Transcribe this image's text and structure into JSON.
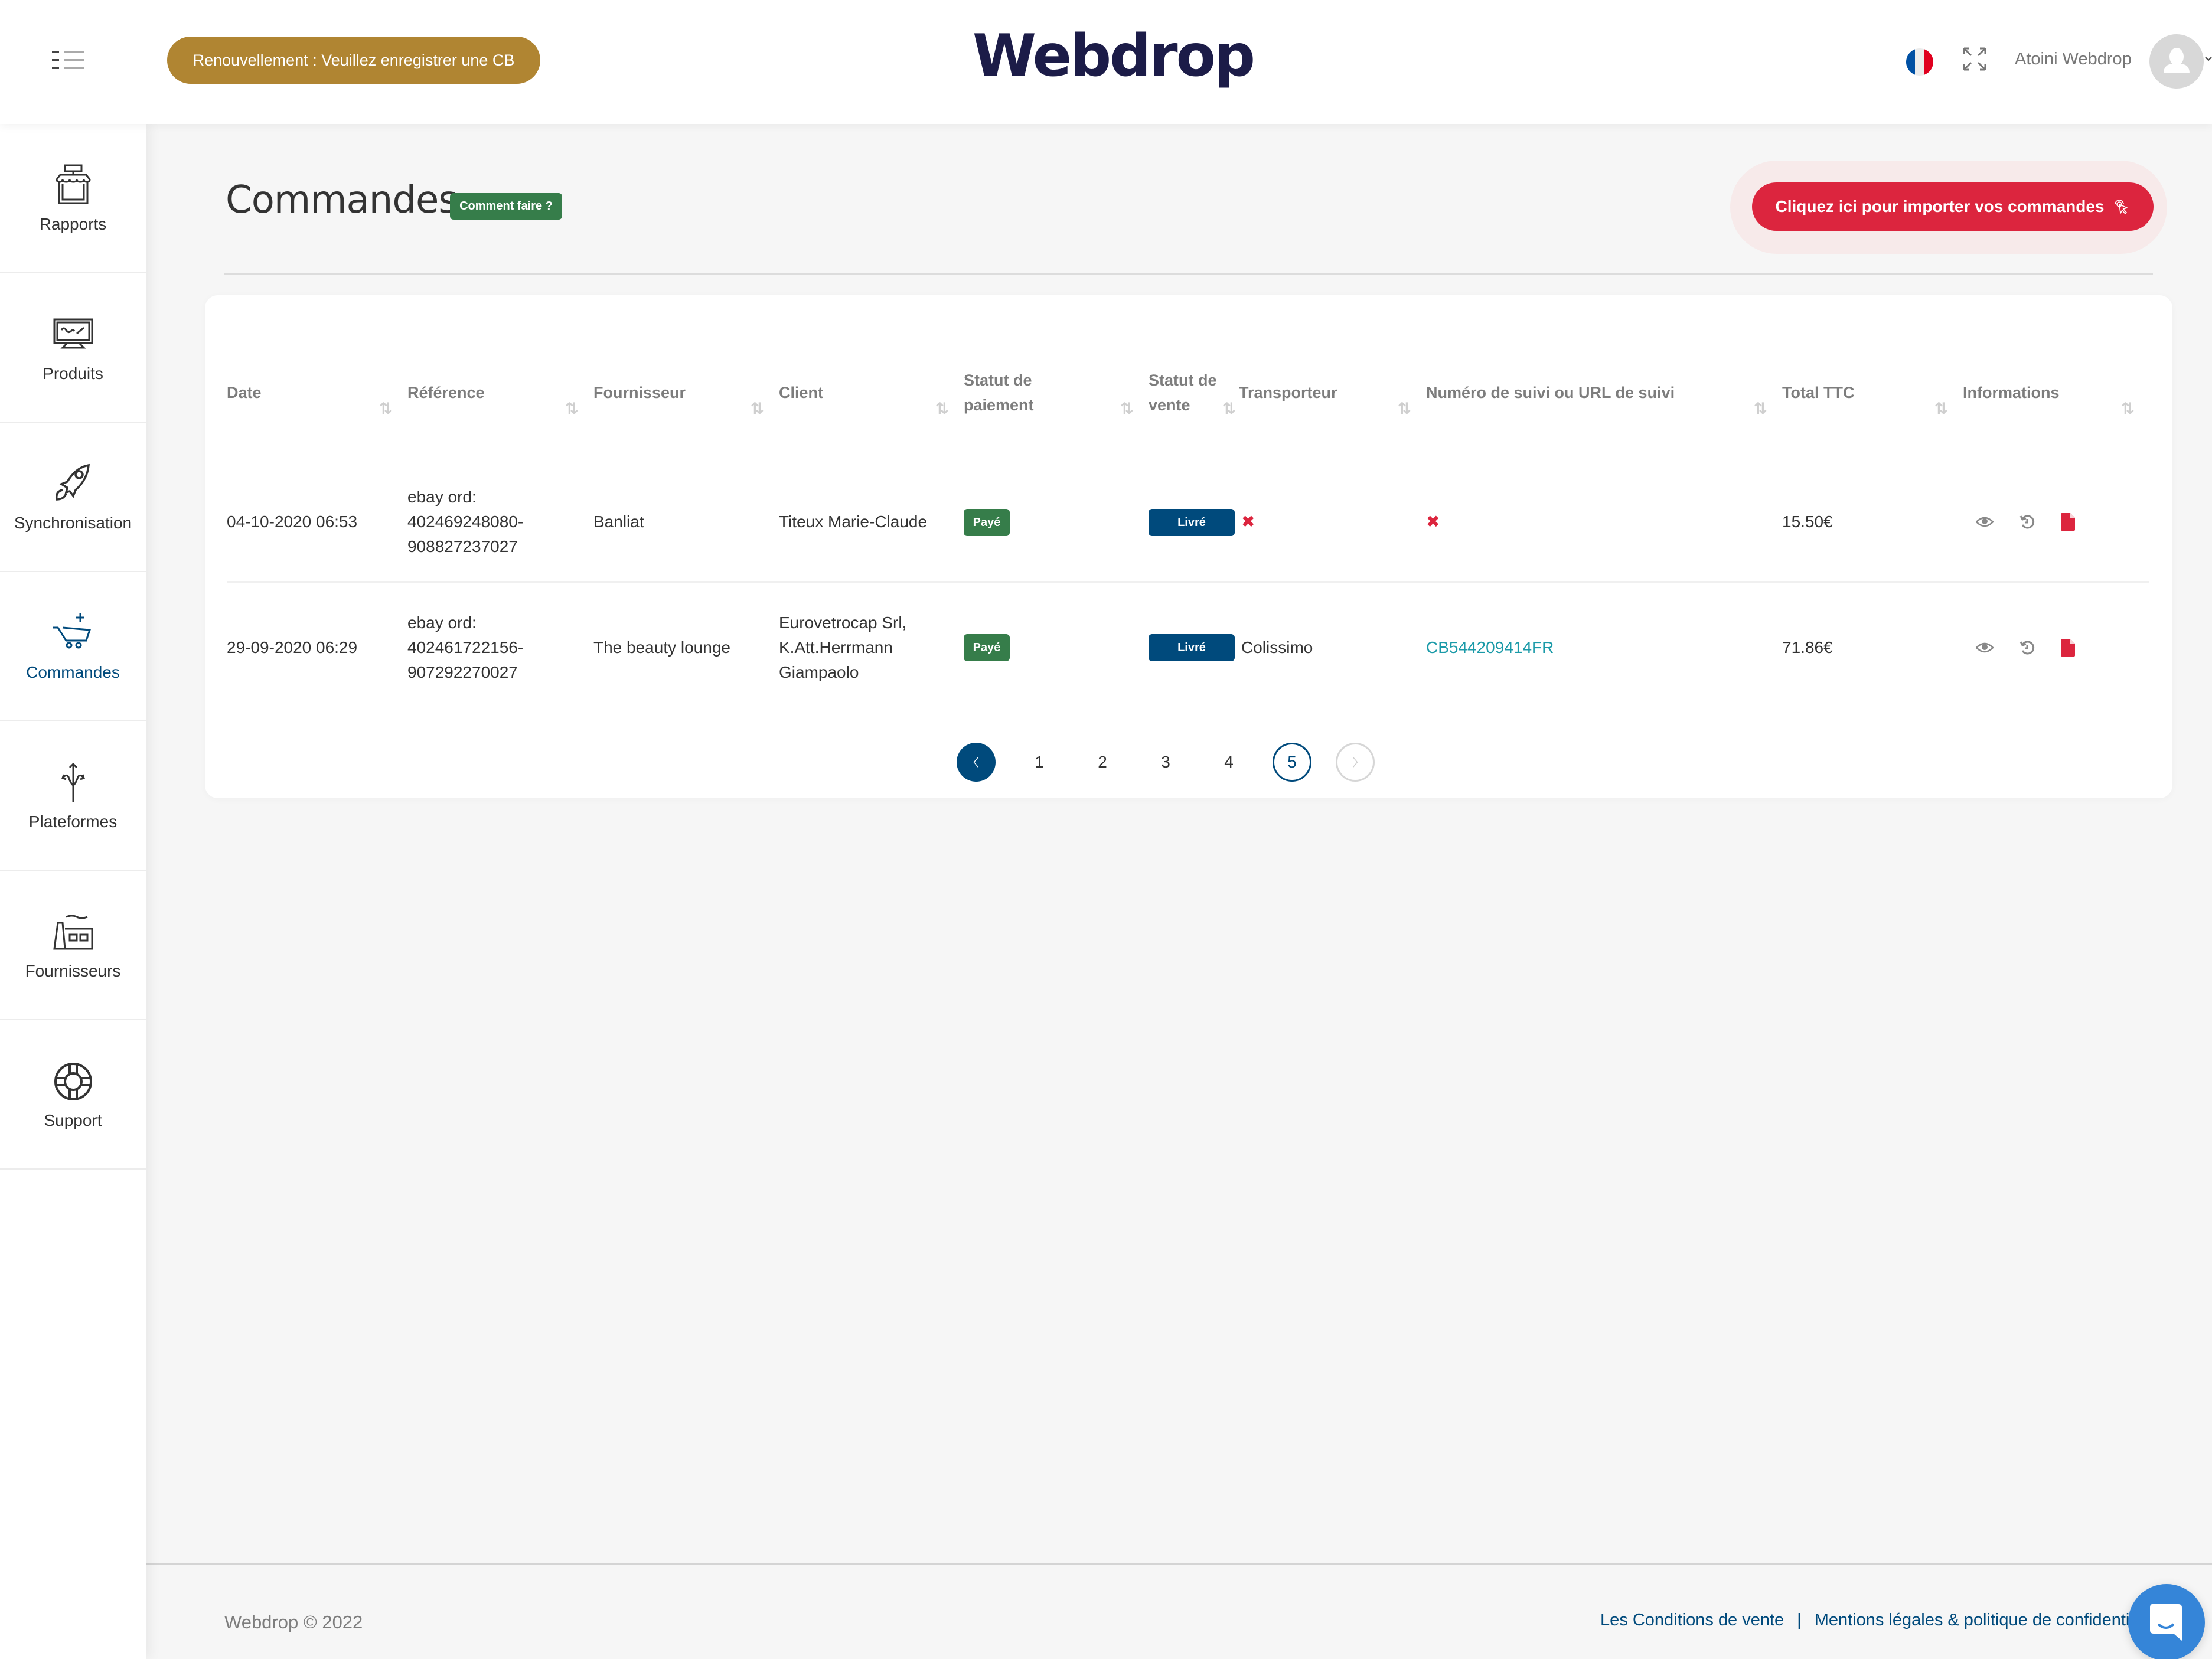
{
  "header": {
    "renewal_banner": "Renouvellement : Veuillez enregistrer une CB",
    "logo": "Webdrop",
    "language": "fr",
    "user_name": "Atoini Webdrop"
  },
  "sidebar": {
    "items": [
      {
        "label": "Rapports",
        "icon": "shop-icon",
        "active": false
      },
      {
        "label": "Produits",
        "icon": "monitor-icon",
        "active": false
      },
      {
        "label": "Synchronisation",
        "icon": "rocket-icon",
        "active": false
      },
      {
        "label": "Commandes",
        "icon": "cart-plus-icon",
        "active": true
      },
      {
        "label": "Plateformes",
        "icon": "trident-icon",
        "active": false
      },
      {
        "label": "Fournisseurs",
        "icon": "factory-icon",
        "active": false
      },
      {
        "label": "Support",
        "icon": "lifebuoy-icon",
        "active": false
      }
    ]
  },
  "page": {
    "title": "Commandes",
    "howto_label": "Comment faire ?",
    "import_label": "Cliquez ici pour importer vos commandes"
  },
  "table": {
    "columns": [
      "Date",
      "Référence",
      "Fournisseur",
      "Client",
      "Statut de paiement",
      "Statut de vente",
      "Transporteur",
      "Numéro de suivi ou URL de suivi",
      "Total TTC",
      "Informations"
    ],
    "rows": [
      {
        "date": "04-10-2020 06:53",
        "reference": [
          "ebay ord:",
          "402469248080-",
          "908827237027"
        ],
        "supplier": "Banliat",
        "client": [
          "Titeux Marie-Claude"
        ],
        "payment_status": "Payé",
        "sale_status": "Livré",
        "carrier": null,
        "tracking": null,
        "total": "15.50€"
      },
      {
        "date": "29-09-2020 06:29",
        "reference": [
          "ebay ord:",
          "402461722156-",
          "907292270027"
        ],
        "supplier": "The beauty lounge",
        "client": [
          "Eurovetrocap Srl,",
          "K.Att.Herrmann",
          "Giampaolo"
        ],
        "payment_status": "Payé",
        "sale_status": "Livré",
        "carrier": "Colissimo",
        "tracking": "CB544209414FR",
        "total": "71.86€"
      }
    ]
  },
  "pagination": {
    "pages": [
      "1",
      "2",
      "3",
      "4",
      "5"
    ],
    "current": "5"
  },
  "footer": {
    "copyright_brand": "Webdrop",
    "copyright_symbol": "©",
    "copyright_year": "2022",
    "links": [
      "Les Conditions de vente",
      "Mentions légales & politique de confidentialité"
    ],
    "separator": "|"
  },
  "colors": {
    "brand_navy": "#1c1c48",
    "primary_blue": "#004a7c",
    "success_green": "#367d4a",
    "danger_red": "#dc253e",
    "renew_gold": "#b08532",
    "link_teal": "#1a9aa8",
    "chat_blue": "#3585d8"
  }
}
